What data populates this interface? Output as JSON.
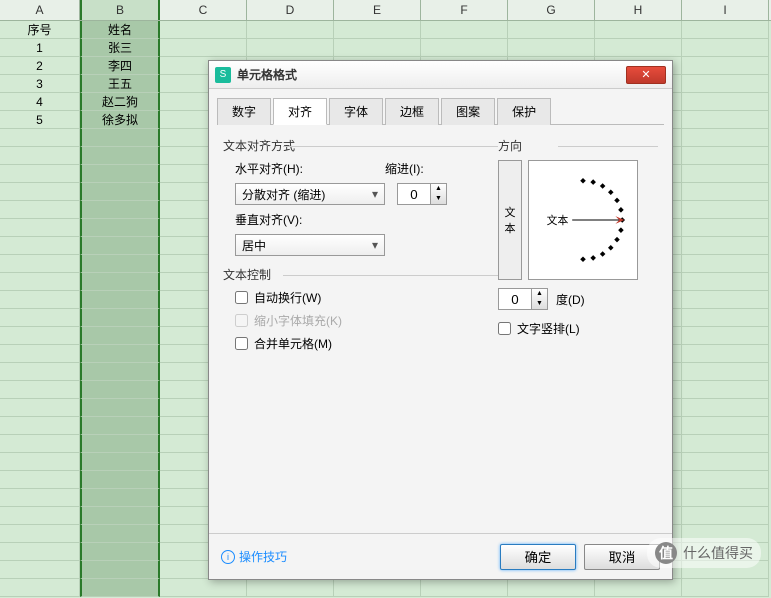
{
  "sheet": {
    "columns": [
      "A",
      "B",
      "C",
      "D",
      "E",
      "F",
      "G",
      "H",
      "I"
    ],
    "rows": [
      {
        "A": "序号",
        "B": "姓名"
      },
      {
        "A": "1",
        "B": "张三"
      },
      {
        "A": "2",
        "B": "李四"
      },
      {
        "A": "3",
        "B": "王五"
      },
      {
        "A": "4",
        "B": "赵二狗"
      },
      {
        "A": "5",
        "B": "徐多拟"
      }
    ]
  },
  "dialog": {
    "title": "单元格格式",
    "tabs": [
      "数字",
      "对齐",
      "字体",
      "边框",
      "图案",
      "保护"
    ],
    "active_tab": 1,
    "align": {
      "section_label": "文本对齐方式",
      "h_label": "水平对齐(H):",
      "h_value": "分散对齐 (缩进)",
      "indent_label": "缩进(I):",
      "indent_value": "0",
      "v_label": "垂直对齐(V):",
      "v_value": "居中"
    },
    "control": {
      "section_label": "文本控制",
      "wrap": "自动换行(W)",
      "shrink": "缩小字体填充(K)",
      "merge": "合并单元格(M)"
    },
    "orient": {
      "section_label": "方向",
      "vert_text_1": "文",
      "vert_text_2": "本",
      "dial_label": "文本",
      "deg_value": "0",
      "deg_label": "度(D)",
      "vertical_chk": "文字竖排(L)"
    },
    "footer": {
      "tips": "操作技巧",
      "ok": "确定",
      "cancel": "取消"
    }
  },
  "watermark": "什么值得买"
}
